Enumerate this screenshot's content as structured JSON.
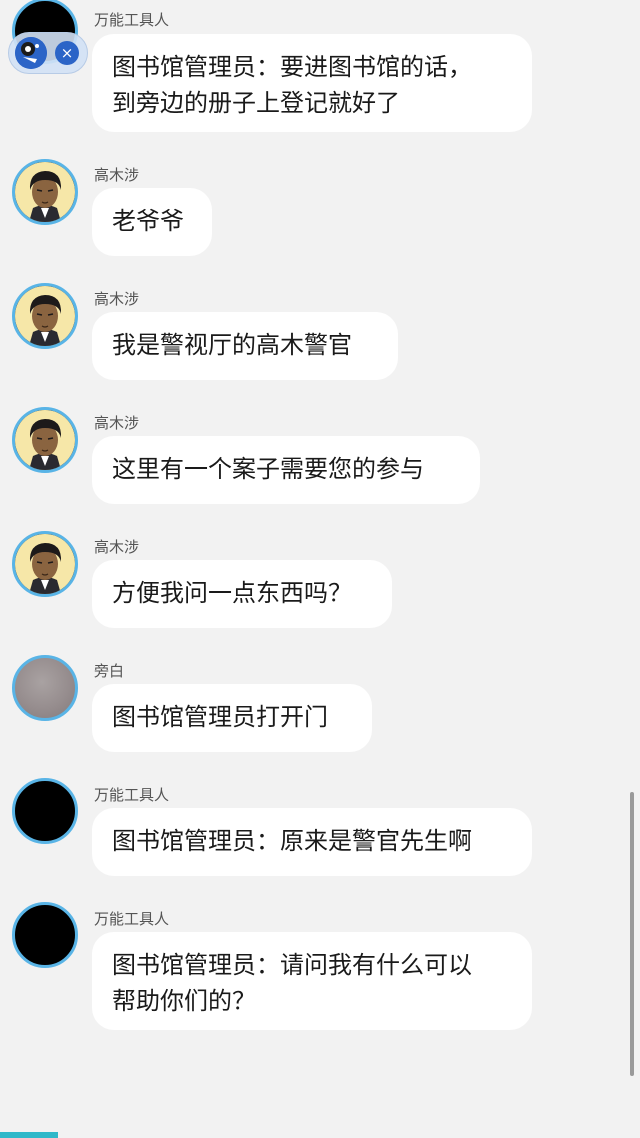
{
  "messages": [
    {
      "sender": "万能工具人",
      "avatar": "black-avatar",
      "text": "图书馆管理员：要进图书馆的话，\n到旁边的册子上登记就好了"
    },
    {
      "sender": "高木涉",
      "avatar": "takagi-avatar",
      "text": "老爷爷"
    },
    {
      "sender": "高木涉",
      "avatar": "takagi-avatar",
      "text": "我是警视厅的高木警官"
    },
    {
      "sender": "高木涉",
      "avatar": "takagi-avatar",
      "text": "这里有一个案子需要您的参与"
    },
    {
      "sender": "高木涉",
      "avatar": "takagi-avatar",
      "text": "方便我问一点东西吗？"
    },
    {
      "sender": "旁白",
      "avatar": "gray-avatar",
      "text": "图书馆管理员打开门"
    },
    {
      "sender": "万能工具人",
      "avatar": "black-avatar",
      "text": "图书馆管理员：原来是警官先生啊"
    },
    {
      "sender": "万能工具人",
      "avatar": "black-avatar",
      "text": "图书馆管理员：请问我有什么可以\n帮助你们的？"
    }
  ],
  "floating_widget": {
    "close_symbol": "×"
  },
  "colors": {
    "background": "#f2f2f2",
    "bubble": "#ffffff",
    "avatar_ring": "#59b4e6",
    "widget_accent": "#2b64c7",
    "bottom_strip": "#2fb8c9"
  }
}
